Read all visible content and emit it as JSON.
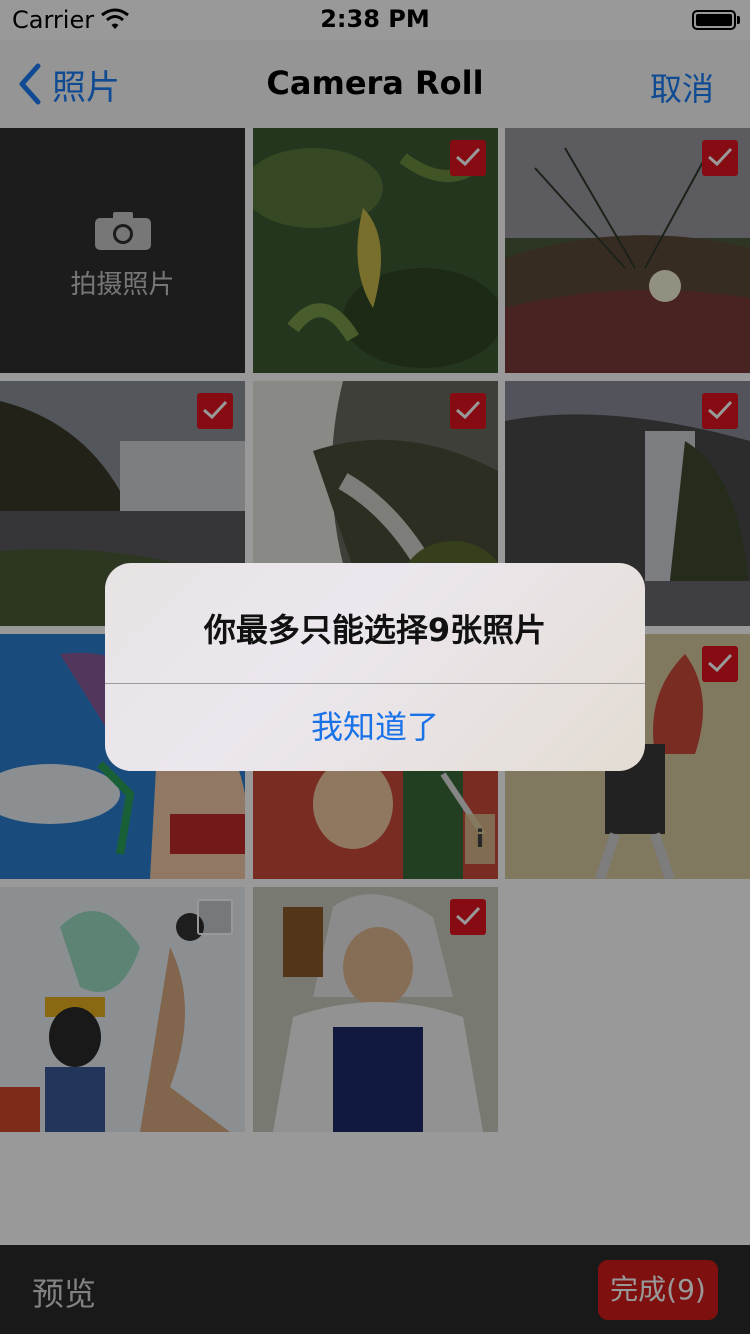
{
  "status_bar": {
    "carrier": "Carrier",
    "time": "2:38 PM"
  },
  "nav": {
    "back_label": "照片",
    "title": "Camera Roll",
    "cancel_label": "取消"
  },
  "camera_cell": {
    "label": "拍摄照片",
    "icon": "camera-icon"
  },
  "photos": [
    {
      "name": "photo-leaves",
      "selected": true
    },
    {
      "name": "photo-flower-field",
      "selected": true
    },
    {
      "name": "photo-waterfall-cliff",
      "selected": true
    },
    {
      "name": "photo-waterfall-closeup",
      "selected": true
    },
    {
      "name": "photo-waterfall-dusk",
      "selected": true
    },
    {
      "name": "photo-anime-beach",
      "selected": false
    },
    {
      "name": "photo-anime-crew",
      "selected": false
    },
    {
      "name": "photo-anime-map",
      "selected": true
    },
    {
      "name": "photo-anime-brook",
      "selected": false
    },
    {
      "name": "photo-anime-rayleigh",
      "selected": true
    }
  ],
  "toolbar": {
    "preview_label": "预览",
    "done_label": "完成(9)"
  },
  "alert": {
    "message": "你最多只能选择9张照片",
    "button_label": "我知道了"
  },
  "colors": {
    "accent": "#1a7cf5",
    "done_button": "#d41c1c",
    "check_selected": "#e0131f"
  }
}
